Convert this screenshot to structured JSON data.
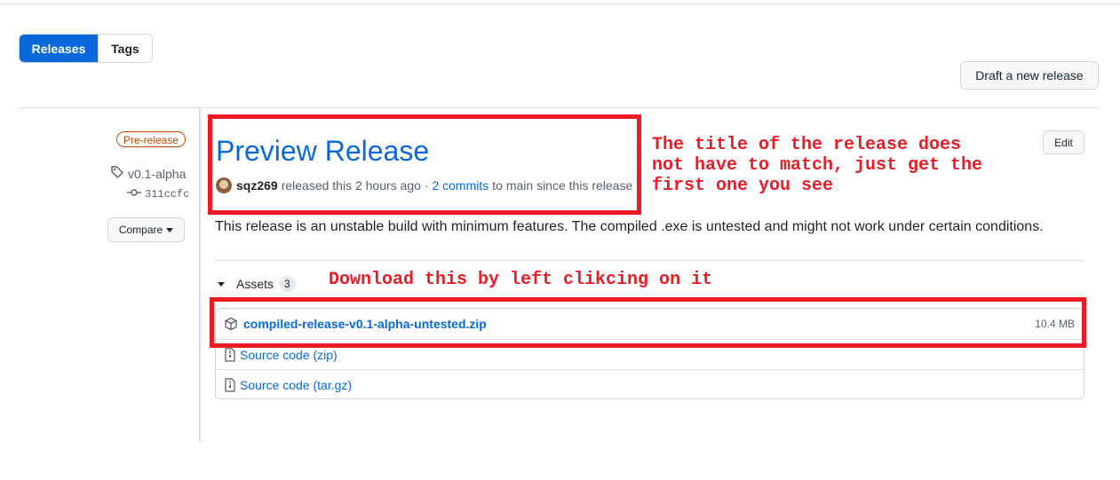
{
  "tabs": {
    "releases": "Releases",
    "tags": "Tags"
  },
  "draft_button": "Draft a new release",
  "sidebar": {
    "badge": "Pre-release",
    "tag": "v0.1-alpha",
    "commit": "311ccfc",
    "compare_label": "Compare"
  },
  "release": {
    "title": "Preview Release",
    "author": "sqz269",
    "released_text": "released this 2 hours ago ·",
    "commits_link": "2 commits",
    "since_text": "to main since this release",
    "edit_label": "Edit",
    "description": "This release is an unstable build with minimum features. The compiled .exe is untested and might not work under certain conditions."
  },
  "assets": {
    "label": "Assets",
    "count": "3",
    "items": [
      {
        "name": "compiled-release-v0.1-alpha-untested.zip",
        "size": "10.4 MB"
      },
      {
        "name": "Source code",
        "suffix": "(zip)"
      },
      {
        "name": "Source code",
        "suffix": "(tar.gz)"
      }
    ]
  },
  "annotations": {
    "title_note": "The title of the release does\nnot have to match, just get the\nfirst one you see",
    "download_note": "Download this by left clikcing on it"
  },
  "colors": {
    "accent": "#0969da",
    "annotation": "#ed1c24",
    "prerelease": "#bc4c00"
  }
}
